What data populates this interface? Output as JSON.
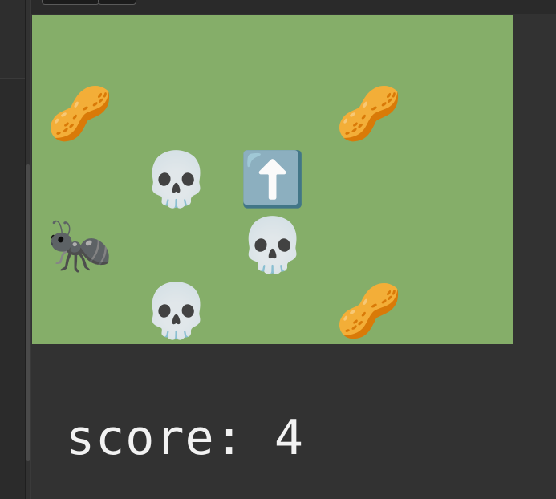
{
  "game": {
    "cells": [
      {
        "row": 1,
        "col": 0,
        "glyph": "🥜",
        "kind": "peanut",
        "icon": "peanut-icon"
      },
      {
        "row": 1,
        "col": 3,
        "glyph": "🥜",
        "kind": "peanut",
        "icon": "peanut-icon"
      },
      {
        "row": 2,
        "col": 1,
        "glyph": "💀",
        "kind": "skull",
        "icon": "skull-icon"
      },
      {
        "row": 2,
        "col": 2,
        "glyph": "⬆️",
        "kind": "up-arrow",
        "icon": "up-arrow-icon"
      },
      {
        "row": 3,
        "col": 0,
        "glyph": "🐜",
        "kind": "ant",
        "icon": "ant-icon"
      },
      {
        "row": 3,
        "col": 2,
        "glyph": "💀",
        "kind": "skull",
        "icon": "skull-icon"
      },
      {
        "row": 4,
        "col": 1,
        "glyph": "💀",
        "kind": "skull",
        "icon": "skull-icon"
      },
      {
        "row": 4,
        "col": 3,
        "glyph": "🥜",
        "kind": "peanut",
        "icon": "peanut-icon"
      }
    ],
    "board_color": "#85ae69"
  },
  "score": {
    "text": "score: 4"
  },
  "theme": {
    "background": "#323232",
    "score_color": "#f2f2f2"
  }
}
